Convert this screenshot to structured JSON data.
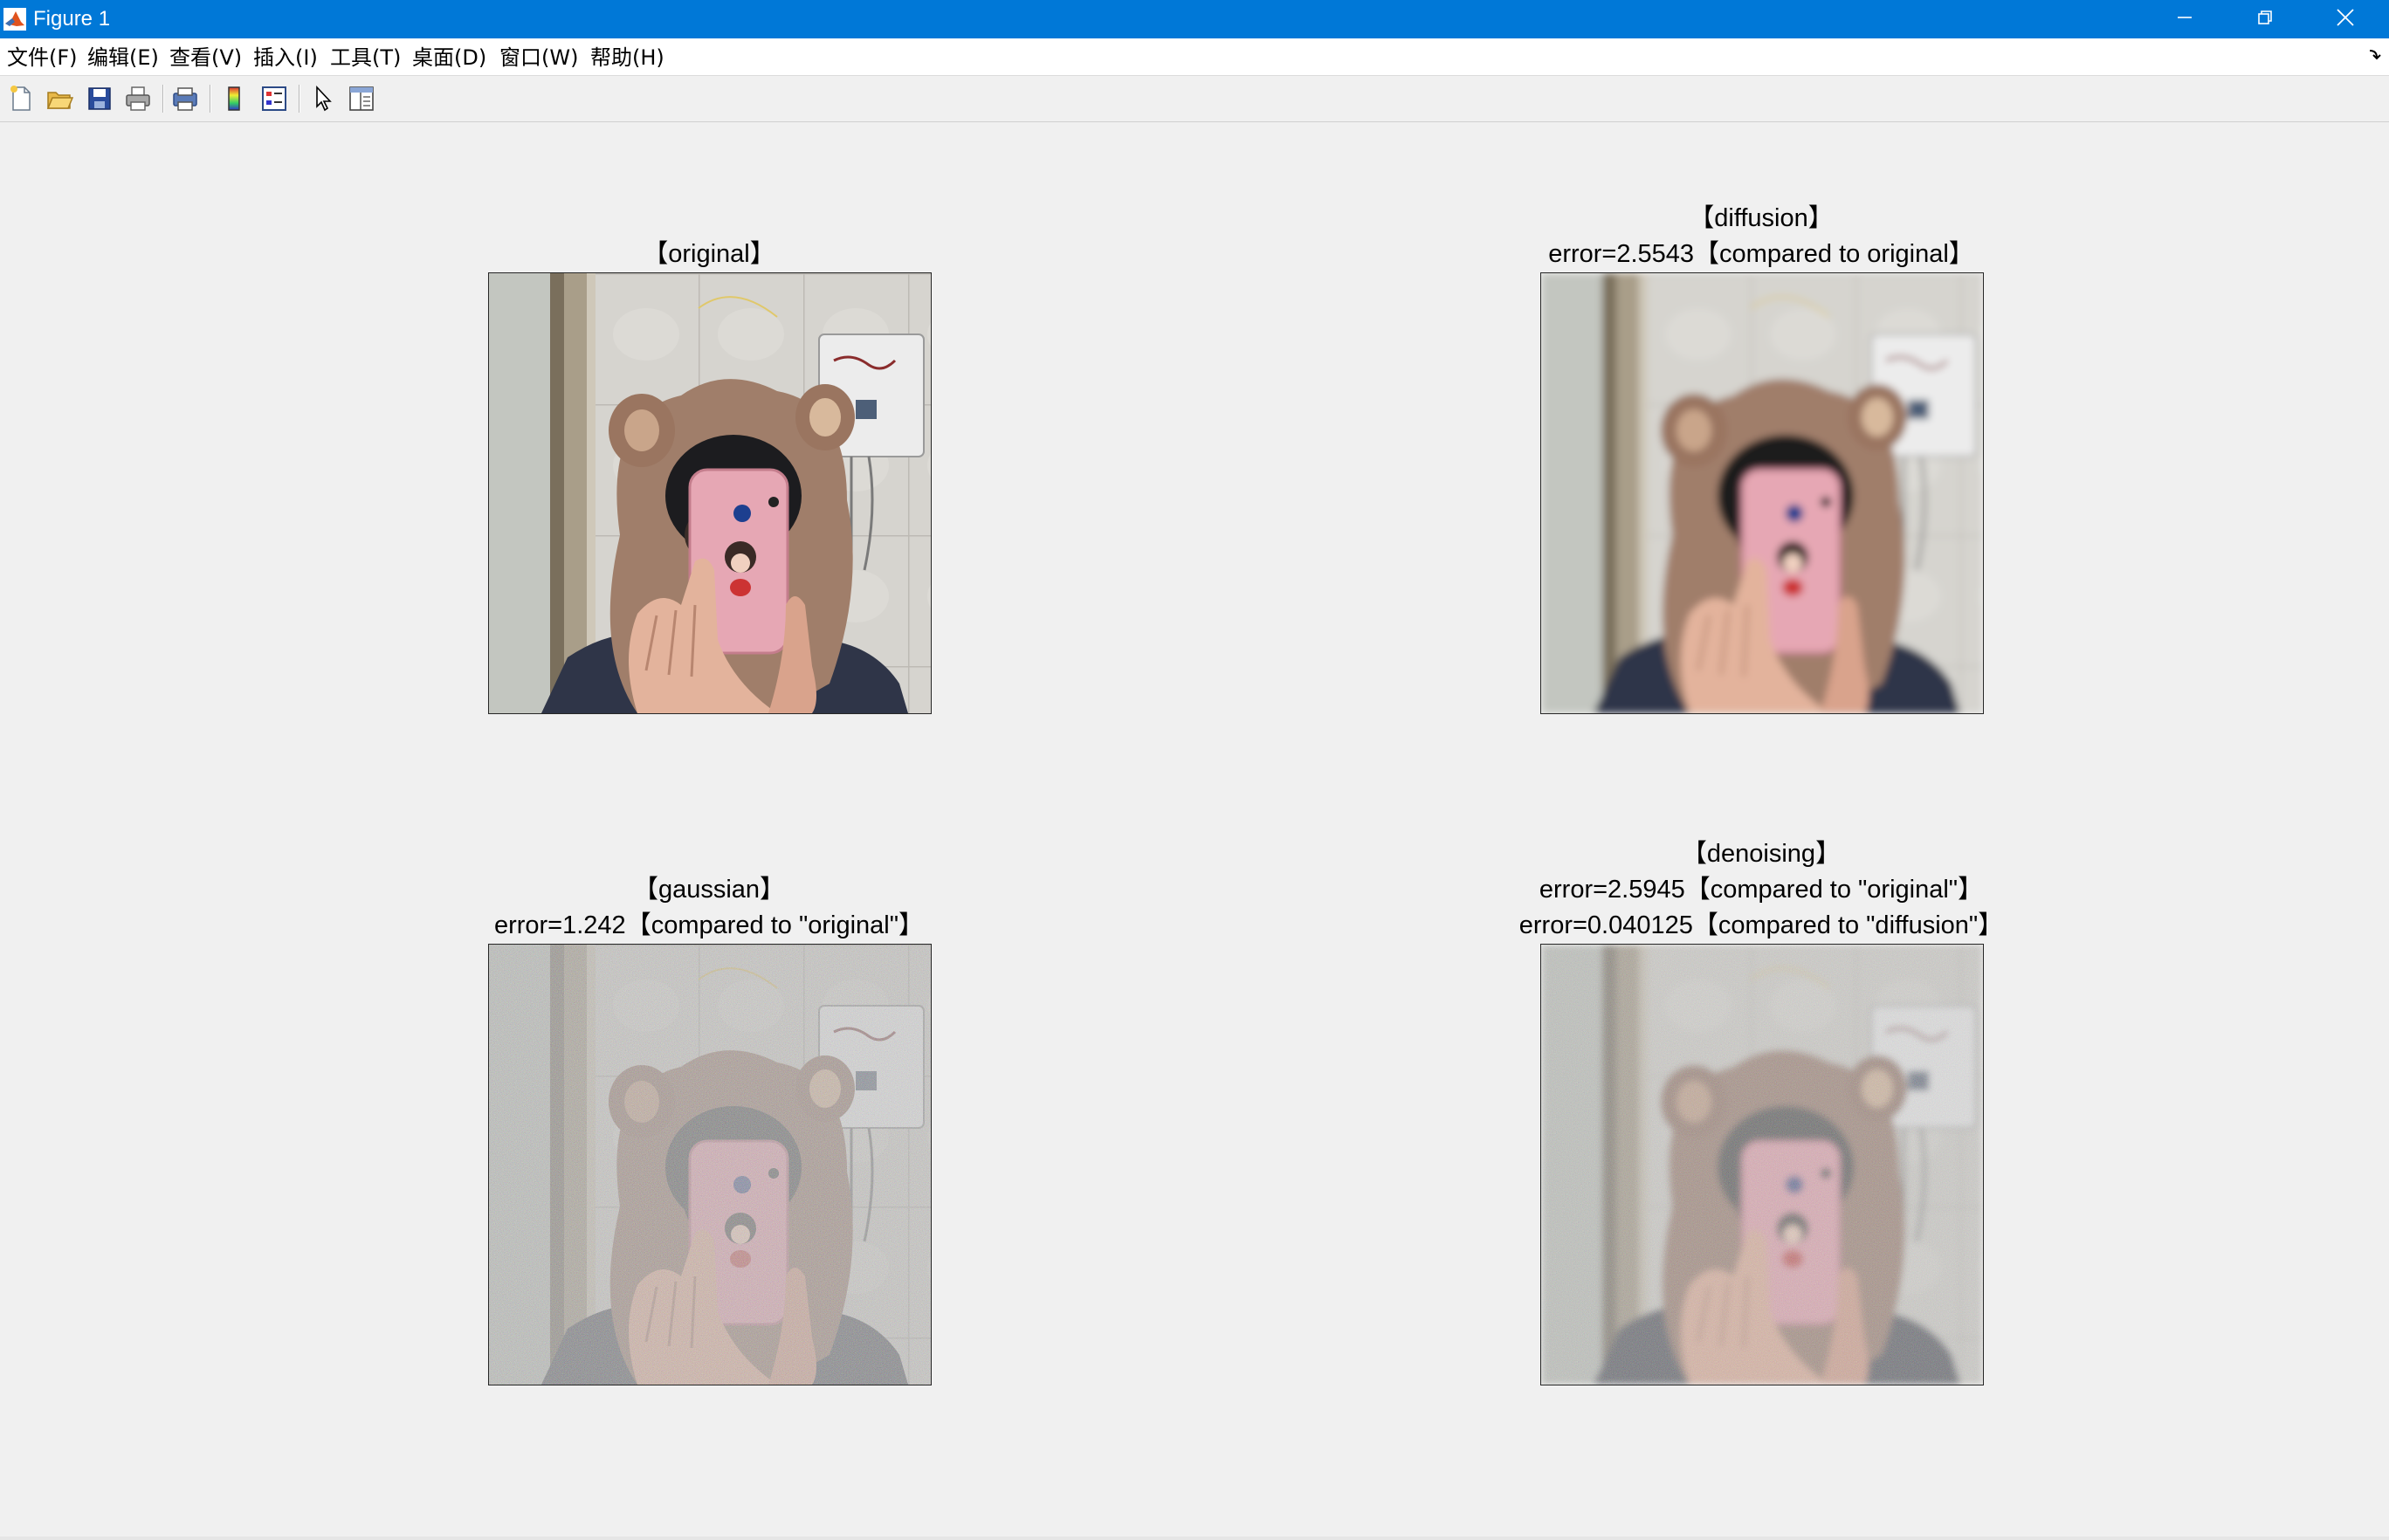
{
  "window": {
    "title": "Figure 1",
    "controls": {
      "minimize": "minimize-icon",
      "maximize": "restore-icon",
      "close": "close-icon"
    }
  },
  "menu": {
    "items": [
      "文件(F)",
      "编辑(E)",
      "查看(V)",
      "插入(I)",
      "工具(T)",
      "桌面(D)",
      "窗口(W)",
      "帮助(H)"
    ],
    "dock_icon": "dock-arrow-icon"
  },
  "toolbar": {
    "buttons": [
      "new-figure-icon",
      "open-file-icon",
      "save-icon",
      "print-icon",
      "print-preview-icon",
      "insert-colorbar-icon",
      "insert-legend-icon",
      "edit-plot-icon",
      "property-inspector-icon"
    ]
  },
  "subplots": {
    "original": {
      "title_lines": [
        "【original】"
      ],
      "image": "Photo of a person in a brown furry bear-ear hood taking a mirror selfie with a pink phone in front of a tiled wall"
    },
    "diffusion": {
      "title_lines": [
        "【diffusion】",
        "error=2.5543【compared to original】"
      ],
      "image": "Blurred version of the selfie"
    },
    "gaussian": {
      "title_lines": [
        "【gaussian】",
        "error=1.242【compared to \"original\"】"
      ],
      "image": "Selfie with heavy colored gaussian noise"
    },
    "denoising": {
      "title_lines": [
        "【denoising】",
        "error=2.5945【compared to \"original\"】",
        "error=0.040125【compared to \"diffusion\"】"
      ],
      "image": "Noisy selfie after partial denoising"
    }
  },
  "colors": {
    "titlebar": "#0078d7",
    "background": "#f0f0f0",
    "hood": "#a07e6a",
    "phone": "#e6a7b4",
    "wall": "#d9d7d2"
  }
}
